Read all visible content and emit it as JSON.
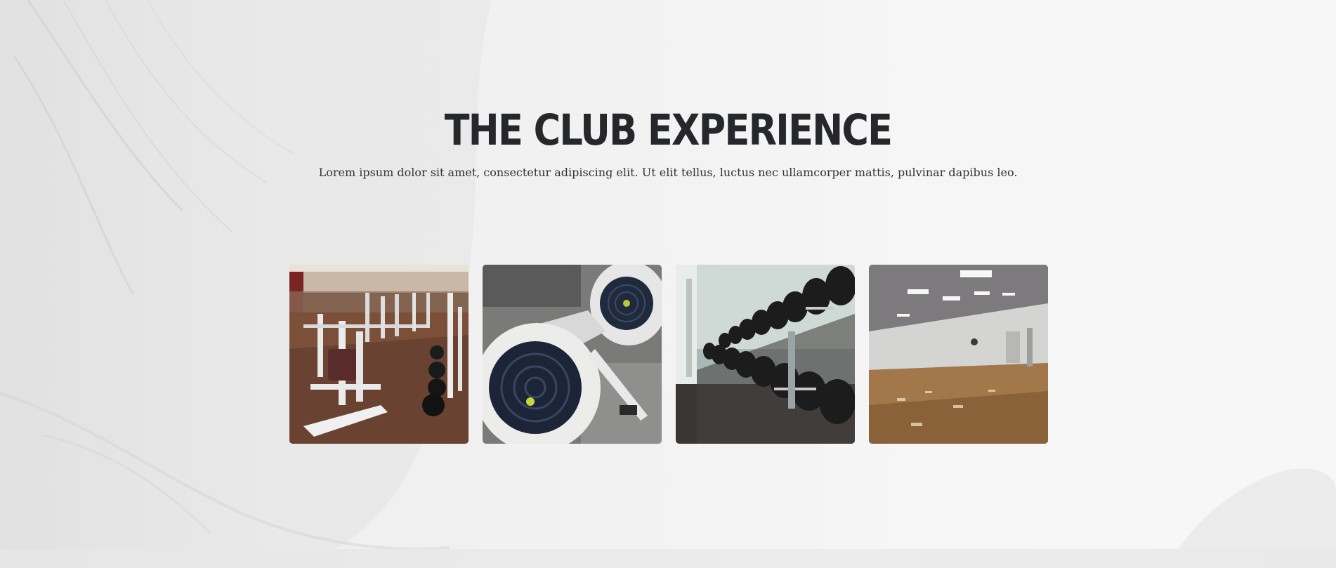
{
  "section": {
    "heading": "THE CLUB EXPERIENCE",
    "subtext": "Lorem ipsum dolor sit amet, consectetur adipiscing elit. Ut elit tellus, luctus nec ullamcorper mattis, pulvinar dapibus leo."
  },
  "gallery": {
    "images": [
      {
        "name": "gym-floor-image"
      },
      {
        "name": "rowing-machines-image"
      },
      {
        "name": "dumbbell-rack-image"
      },
      {
        "name": "studio-room-image"
      }
    ]
  },
  "colors": {
    "heading": "#26272b",
    "text": "#333333",
    "background": "#f3f3f3"
  }
}
